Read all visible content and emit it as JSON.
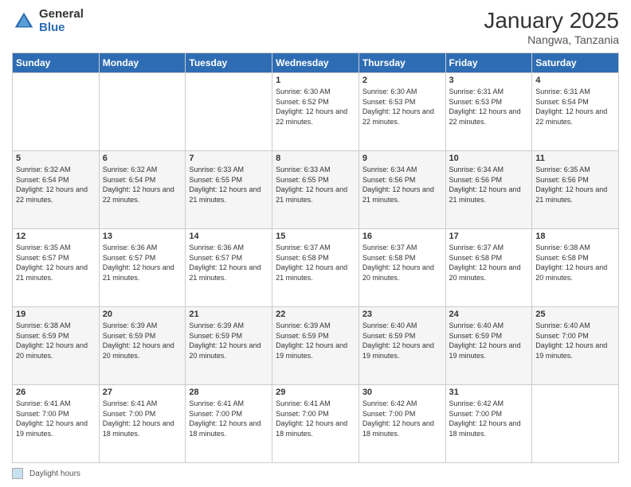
{
  "header": {
    "logo_general": "General",
    "logo_blue": "Blue",
    "month": "January 2025",
    "location": "Nangwa, Tanzania"
  },
  "days_of_week": [
    "Sunday",
    "Monday",
    "Tuesday",
    "Wednesday",
    "Thursday",
    "Friday",
    "Saturday"
  ],
  "weeks": [
    [
      {
        "day": "",
        "info": ""
      },
      {
        "day": "",
        "info": ""
      },
      {
        "day": "",
        "info": ""
      },
      {
        "day": "1",
        "sunrise": "Sunrise: 6:30 AM",
        "sunset": "Sunset: 6:52 PM",
        "daylight": "Daylight: 12 hours and 22 minutes."
      },
      {
        "day": "2",
        "sunrise": "Sunrise: 6:30 AM",
        "sunset": "Sunset: 6:53 PM",
        "daylight": "Daylight: 12 hours and 22 minutes."
      },
      {
        "day": "3",
        "sunrise": "Sunrise: 6:31 AM",
        "sunset": "Sunset: 6:53 PM",
        "daylight": "Daylight: 12 hours and 22 minutes."
      },
      {
        "day": "4",
        "sunrise": "Sunrise: 6:31 AM",
        "sunset": "Sunset: 6:54 PM",
        "daylight": "Daylight: 12 hours and 22 minutes."
      }
    ],
    [
      {
        "day": "5",
        "sunrise": "Sunrise: 6:32 AM",
        "sunset": "Sunset: 6:54 PM",
        "daylight": "Daylight: 12 hours and 22 minutes."
      },
      {
        "day": "6",
        "sunrise": "Sunrise: 6:32 AM",
        "sunset": "Sunset: 6:54 PM",
        "daylight": "Daylight: 12 hours and 22 minutes."
      },
      {
        "day": "7",
        "sunrise": "Sunrise: 6:33 AM",
        "sunset": "Sunset: 6:55 PM",
        "daylight": "Daylight: 12 hours and 21 minutes."
      },
      {
        "day": "8",
        "sunrise": "Sunrise: 6:33 AM",
        "sunset": "Sunset: 6:55 PM",
        "daylight": "Daylight: 12 hours and 21 minutes."
      },
      {
        "day": "9",
        "sunrise": "Sunrise: 6:34 AM",
        "sunset": "Sunset: 6:56 PM",
        "daylight": "Daylight: 12 hours and 21 minutes."
      },
      {
        "day": "10",
        "sunrise": "Sunrise: 6:34 AM",
        "sunset": "Sunset: 6:56 PM",
        "daylight": "Daylight: 12 hours and 21 minutes."
      },
      {
        "day": "11",
        "sunrise": "Sunrise: 6:35 AM",
        "sunset": "Sunset: 6:56 PM",
        "daylight": "Daylight: 12 hours and 21 minutes."
      }
    ],
    [
      {
        "day": "12",
        "sunrise": "Sunrise: 6:35 AM",
        "sunset": "Sunset: 6:57 PM",
        "daylight": "Daylight: 12 hours and 21 minutes."
      },
      {
        "day": "13",
        "sunrise": "Sunrise: 6:36 AM",
        "sunset": "Sunset: 6:57 PM",
        "daylight": "Daylight: 12 hours and 21 minutes."
      },
      {
        "day": "14",
        "sunrise": "Sunrise: 6:36 AM",
        "sunset": "Sunset: 6:57 PM",
        "daylight": "Daylight: 12 hours and 21 minutes."
      },
      {
        "day": "15",
        "sunrise": "Sunrise: 6:37 AM",
        "sunset": "Sunset: 6:58 PM",
        "daylight": "Daylight: 12 hours and 21 minutes."
      },
      {
        "day": "16",
        "sunrise": "Sunrise: 6:37 AM",
        "sunset": "Sunset: 6:58 PM",
        "daylight": "Daylight: 12 hours and 20 minutes."
      },
      {
        "day": "17",
        "sunrise": "Sunrise: 6:37 AM",
        "sunset": "Sunset: 6:58 PM",
        "daylight": "Daylight: 12 hours and 20 minutes."
      },
      {
        "day": "18",
        "sunrise": "Sunrise: 6:38 AM",
        "sunset": "Sunset: 6:58 PM",
        "daylight": "Daylight: 12 hours and 20 minutes."
      }
    ],
    [
      {
        "day": "19",
        "sunrise": "Sunrise: 6:38 AM",
        "sunset": "Sunset: 6:59 PM",
        "daylight": "Daylight: 12 hours and 20 minutes."
      },
      {
        "day": "20",
        "sunrise": "Sunrise: 6:39 AM",
        "sunset": "Sunset: 6:59 PM",
        "daylight": "Daylight: 12 hours and 20 minutes."
      },
      {
        "day": "21",
        "sunrise": "Sunrise: 6:39 AM",
        "sunset": "Sunset: 6:59 PM",
        "daylight": "Daylight: 12 hours and 20 minutes."
      },
      {
        "day": "22",
        "sunrise": "Sunrise: 6:39 AM",
        "sunset": "Sunset: 6:59 PM",
        "daylight": "Daylight: 12 hours and 19 minutes."
      },
      {
        "day": "23",
        "sunrise": "Sunrise: 6:40 AM",
        "sunset": "Sunset: 6:59 PM",
        "daylight": "Daylight: 12 hours and 19 minutes."
      },
      {
        "day": "24",
        "sunrise": "Sunrise: 6:40 AM",
        "sunset": "Sunset: 6:59 PM",
        "daylight": "Daylight: 12 hours and 19 minutes."
      },
      {
        "day": "25",
        "sunrise": "Sunrise: 6:40 AM",
        "sunset": "Sunset: 7:00 PM",
        "daylight": "Daylight: 12 hours and 19 minutes."
      }
    ],
    [
      {
        "day": "26",
        "sunrise": "Sunrise: 6:41 AM",
        "sunset": "Sunset: 7:00 PM",
        "daylight": "Daylight: 12 hours and 19 minutes."
      },
      {
        "day": "27",
        "sunrise": "Sunrise: 6:41 AM",
        "sunset": "Sunset: 7:00 PM",
        "daylight": "Daylight: 12 hours and 18 minutes."
      },
      {
        "day": "28",
        "sunrise": "Sunrise: 6:41 AM",
        "sunset": "Sunset: 7:00 PM",
        "daylight": "Daylight: 12 hours and 18 minutes."
      },
      {
        "day": "29",
        "sunrise": "Sunrise: 6:41 AM",
        "sunset": "Sunset: 7:00 PM",
        "daylight": "Daylight: 12 hours and 18 minutes."
      },
      {
        "day": "30",
        "sunrise": "Sunrise: 6:42 AM",
        "sunset": "Sunset: 7:00 PM",
        "daylight": "Daylight: 12 hours and 18 minutes."
      },
      {
        "day": "31",
        "sunrise": "Sunrise: 6:42 AM",
        "sunset": "Sunset: 7:00 PM",
        "daylight": "Daylight: 12 hours and 18 minutes."
      },
      {
        "day": "",
        "info": ""
      }
    ]
  ],
  "footer": {
    "daylight_label": "Daylight hours"
  }
}
